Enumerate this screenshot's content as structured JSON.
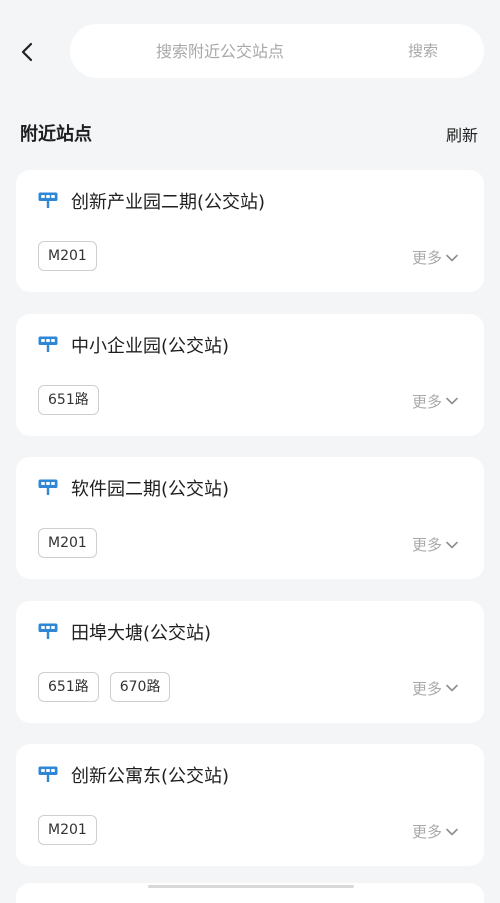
{
  "search": {
    "placeholder": "搜索附近公交站点",
    "button_label": "搜索"
  },
  "section": {
    "title": "附近站点",
    "refresh_label": "刷新"
  },
  "more_label": "更多",
  "colors": {
    "accent": "#2f86d6",
    "background": "#f4f5f7",
    "card": "#ffffff",
    "muted_text": "#a9a9a9",
    "tag_border": "#cfcfcf"
  },
  "icons": {
    "back": "chevron-left-icon",
    "stop": "bus-stop-icon",
    "expand": "chevron-down-icon"
  },
  "stops": [
    {
      "name": "创新产业园二期(公交站)",
      "routes": [
        "M201"
      ]
    },
    {
      "name": "中小企业园(公交站)",
      "routes": [
        "651路"
      ]
    },
    {
      "name": "软件园二期(公交站)",
      "routes": [
        "M201"
      ]
    },
    {
      "name": "田埠大塘(公交站)",
      "routes": [
        "651路",
        "670路"
      ]
    },
    {
      "name": "创新公寓东(公交站)",
      "routes": [
        "M201"
      ]
    }
  ]
}
